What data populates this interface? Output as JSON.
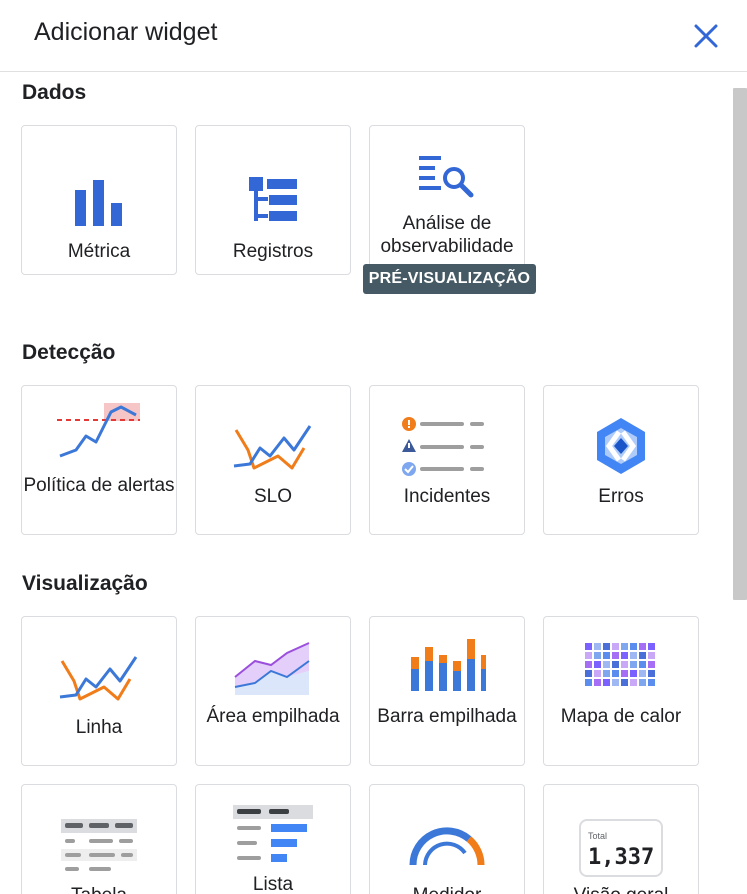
{
  "header": {
    "title": "Adicionar widget",
    "close_icon": "close-icon"
  },
  "sections": {
    "dados": {
      "title": "Dados",
      "cards": [
        {
          "label": "Métrica",
          "icon": "bar-chart-icon"
        },
        {
          "label": "Registros",
          "icon": "logs-icon"
        },
        {
          "label": "Análise de observabilidade",
          "icon": "search-list-icon",
          "badge": "PRÉ-VISUALIZAÇÃO"
        }
      ]
    },
    "deteccao": {
      "title": "Detecção",
      "cards": [
        {
          "label": "Política de alertas",
          "icon": "alert-policy-icon"
        },
        {
          "label": "SLO",
          "icon": "slo-icon"
        },
        {
          "label": "Incidentes",
          "icon": "incidents-icon"
        },
        {
          "label": "Erros",
          "icon": "error-reporting-icon"
        }
      ]
    },
    "visualizacao": {
      "title": "Visualização",
      "cards": [
        {
          "label": "Linha",
          "icon": "line-chart-icon"
        },
        {
          "label": "Área empilhada",
          "icon": "stacked-area-icon"
        },
        {
          "label": "Barra empilhada",
          "icon": "stacked-bar-icon"
        },
        {
          "label": "Mapa de calor",
          "icon": "heatmap-icon"
        },
        {
          "label": "Tabela",
          "icon": "table-icon"
        },
        {
          "label": "Lista",
          "icon": "list-icon"
        },
        {
          "label": "Medidor",
          "icon": "gauge-icon"
        },
        {
          "label": "Visão geral",
          "icon": "scorecard-icon",
          "total_label": "Total",
          "total_value": "1,337"
        }
      ]
    }
  },
  "colors": {
    "blue": "#3367d6",
    "orange": "#f07c1a",
    "purple": "#8e44d9",
    "badge": "#455a64"
  }
}
